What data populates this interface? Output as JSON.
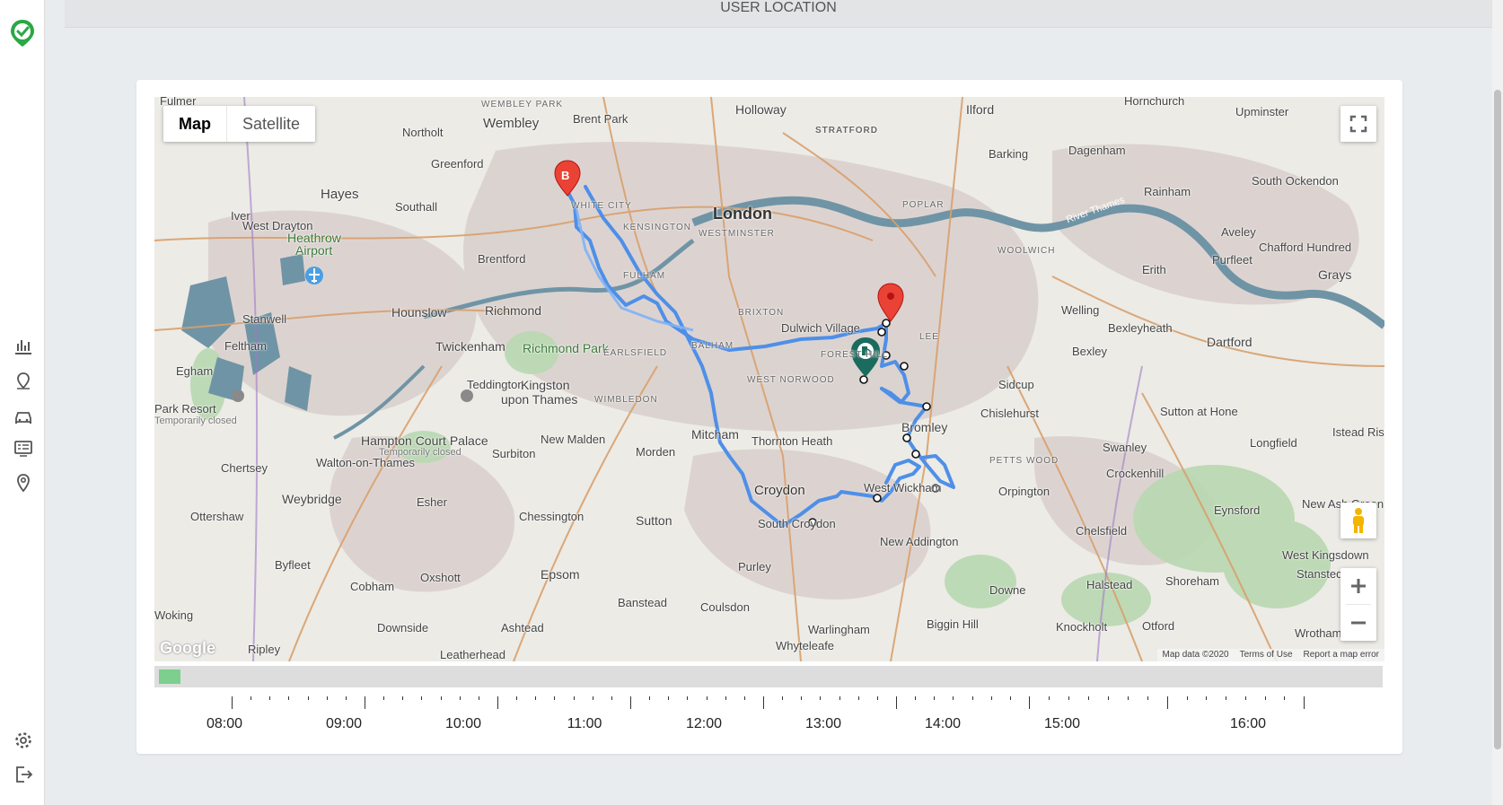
{
  "header": {
    "title": "USER LOCATION"
  },
  "sidebar": {
    "icons": [
      "app-logo-icon",
      "analytics-icon",
      "location-pin-icon",
      "car-icon",
      "list-icon",
      "map-marker-icon",
      "gear-icon",
      "logout-icon"
    ]
  },
  "map": {
    "map_type": {
      "map_label": "Map",
      "satellite_label": "Satellite",
      "selected": "Map"
    },
    "google_logo": "Google",
    "attribution": {
      "data": "Map data ©2020",
      "terms": "Terms of Use",
      "report": "Report a map error"
    },
    "marker_b_label": "B",
    "labels": {
      "wembley_park": "WEMBLEY PARK",
      "holloway": "Holloway",
      "stratford": "STRATFORD",
      "ilford": "Ilford",
      "hornchurch": "Hornchurch",
      "upminster": "Upminster",
      "fulmer": "Fulmer",
      "brent_park": "Brent Park",
      "wembley": "Wembley",
      "northolt": "Northolt",
      "greenford": "Greenford",
      "barking": "Barking",
      "dagenham": "Dagenham",
      "hayes": "Hayes",
      "southall": "Southall",
      "iver": "Iver",
      "west_drayton": "West Drayton",
      "heathrow": "Heathrow",
      "airport": "Airport",
      "london": "London",
      "kensington": "KENSINGTON",
      "westminster": "WESTMINSTER",
      "white_city": "WHITE CITY",
      "poplar": "POPLAR",
      "woolwich": "WOOLWICH",
      "brentford": "Brentford",
      "fulham": "FULHAM",
      "brixton": "BRIXTON",
      "rainham": "Rainham",
      "south_ockendon": "South Ockendon",
      "aveley": "Aveley",
      "purfleet": "Purfleet",
      "chafford_hundred": "Chafford Hundred",
      "grays": "Grays",
      "erith": "Erith",
      "river_thames": "River Thames",
      "hounslow": "Hounslow",
      "richmond": "Richmond",
      "stanwell": "Stanwell",
      "welling": "Welling",
      "bexleyheath": "Bexleyheath",
      "dartford": "Dartford",
      "feltham": "Feltham",
      "twickenham": "Twickenham",
      "richmond_park": "Richmond Park",
      "dulwich_village": "Dulwich Village",
      "forest_hill": "FOREST HILL",
      "lee": "LEE",
      "earlsfield": "EARLSFIELD",
      "balham": "BALHAM",
      "bexley": "Bexley",
      "egham": "Egham",
      "teddington": "Teddington",
      "kingston": "Kingston",
      "upon_thames": "upon Thames",
      "wimbledon": "WIMBLEDON",
      "west_norwood": "WEST NORWOOD",
      "sidcup": "Sidcup",
      "chislehurst": "Chislehurst",
      "sutton_at_hone": "Sutton at Hone",
      "park_resort": "Park Resort",
      "temporarily_closed": "Temporarily closed",
      "hampton_court_palace": "Hampton Court Palace",
      "new_malden": "New Malden",
      "mitcham": "Mitcham",
      "thornton_heath": "Thornton Heath",
      "bromley": "Bromley",
      "swanley": "Swanley",
      "longfield": "Longfield",
      "isead_rise": "Istead Rise",
      "chertsey": "Chertsey",
      "walton": "Walton-on-Thames",
      "surbiton": "Surbiton",
      "morden": "Morden",
      "petts_wood": "PETTS WOOD",
      "crockenhill": "Crockenhill",
      "weybridge": "Weybridge",
      "esher": "Esher",
      "chessington": "Chessington",
      "croydon": "Croydon",
      "west_wickham": "West Wickham",
      "orpington": "Orpington",
      "new_ash_green": "New Ash Green",
      "eynsford": "Eynsford",
      "ottershaw": "Ottershaw",
      "sutton": "Sutton",
      "south_croydon": "South Croydon",
      "new_addington": "New Addington",
      "chelsfield": "Chelsfield",
      "byfleet": "Byfleet",
      "cobham": "Cobham",
      "oxshott": "Oxshott",
      "epsom": "Epsom",
      "purley": "Purley",
      "west_kingsdown": "West Kingsdown",
      "stansted": "Stansted",
      "halstead": "Halstead",
      "shoreham": "Shoreham",
      "downe": "Downe",
      "banstead": "Banstead",
      "coulsdon": "Coulsdon",
      "woking": "Woking",
      "downside": "Downside",
      "ashtead": "Ashtead",
      "warlingham": "Warlingham",
      "biggin_hill": "Biggin Hill",
      "knockholt": "Knockholt",
      "otford": "Otford",
      "wrotham": "Wrotham",
      "ripley": "Ripley",
      "leatherhead": "Leatherhead",
      "whyteleafe": "Whyteleafe"
    }
  },
  "timeline": {
    "progress": 0.018,
    "hours": [
      "08:00",
      "09:00",
      "10:00",
      "11:00",
      "12:00",
      "13:00",
      "14:00",
      "15:00",
      "16:00"
    ]
  },
  "colors": {
    "route": "#4e8fe8",
    "route_light": "#7fb3f5",
    "marker_red": "#ea4335",
    "marker_green": "#1b6b5e",
    "thames": "#6f94a6",
    "accent": "#2aa845"
  }
}
